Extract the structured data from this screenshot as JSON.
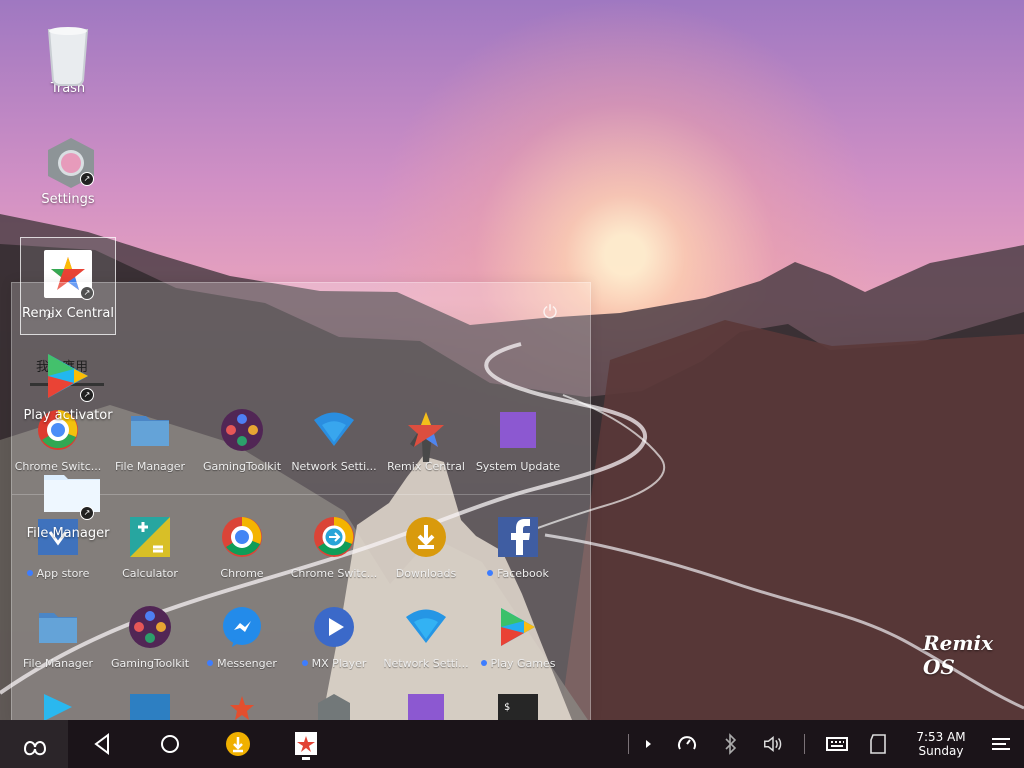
{
  "desktop": {
    "icons": [
      {
        "label": "Trash",
        "icon": "trash-icon"
      },
      {
        "label": "Settings",
        "icon": "settings-icon"
      },
      {
        "label": "Remix Central",
        "icon": "remix-central-icon"
      },
      {
        "label": "Play activator",
        "icon": "play-store-icon"
      },
      {
        "label": "File Manager",
        "icon": "folder-icon"
      }
    ],
    "brand": "Remix OS"
  },
  "drawer": {
    "title": "我的應用",
    "rows": [
      [
        {
          "label": "Chrome Switc...",
          "icon": "chrome-switch-icon",
          "dot": false
        },
        {
          "label": "File Manager",
          "icon": "folder-icon",
          "dot": false
        },
        {
          "label": "GamingToolkit",
          "icon": "gamepad-icon",
          "dot": false
        },
        {
          "label": "Network Setti...",
          "icon": "wifi-icon",
          "dot": false
        },
        {
          "label": "Remix Central",
          "icon": "remix-central-icon",
          "dot": false
        },
        {
          "label": "System Update",
          "icon": "system-update-icon",
          "dot": false
        }
      ],
      [
        {
          "label": "App store",
          "icon": "app-store-icon",
          "dot": true
        },
        {
          "label": "Calculator",
          "icon": "calculator-icon",
          "dot": false
        },
        {
          "label": "Chrome",
          "icon": "chrome-icon",
          "dot": false
        },
        {
          "label": "Chrome Switc...",
          "icon": "chrome-switch-icon",
          "dot": false
        },
        {
          "label": "Downloads",
          "icon": "download-icon",
          "dot": false
        },
        {
          "label": "Facebook",
          "icon": "facebook-icon",
          "dot": true
        }
      ],
      [
        {
          "label": "File Manager",
          "icon": "folder-icon",
          "dot": false
        },
        {
          "label": "GamingToolkit",
          "icon": "gamepad-icon",
          "dot": false
        },
        {
          "label": "Messenger",
          "icon": "messenger-icon",
          "dot": true
        },
        {
          "label": "MX Player",
          "icon": "play-icon",
          "dot": true
        },
        {
          "label": "Network Setti...",
          "icon": "wifi-icon",
          "dot": false
        },
        {
          "label": "Play Games",
          "icon": "play-games-icon",
          "dot": true
        }
      ]
    ]
  },
  "taskbar": {
    "time": "7:53 AM",
    "day": "Sunday"
  }
}
